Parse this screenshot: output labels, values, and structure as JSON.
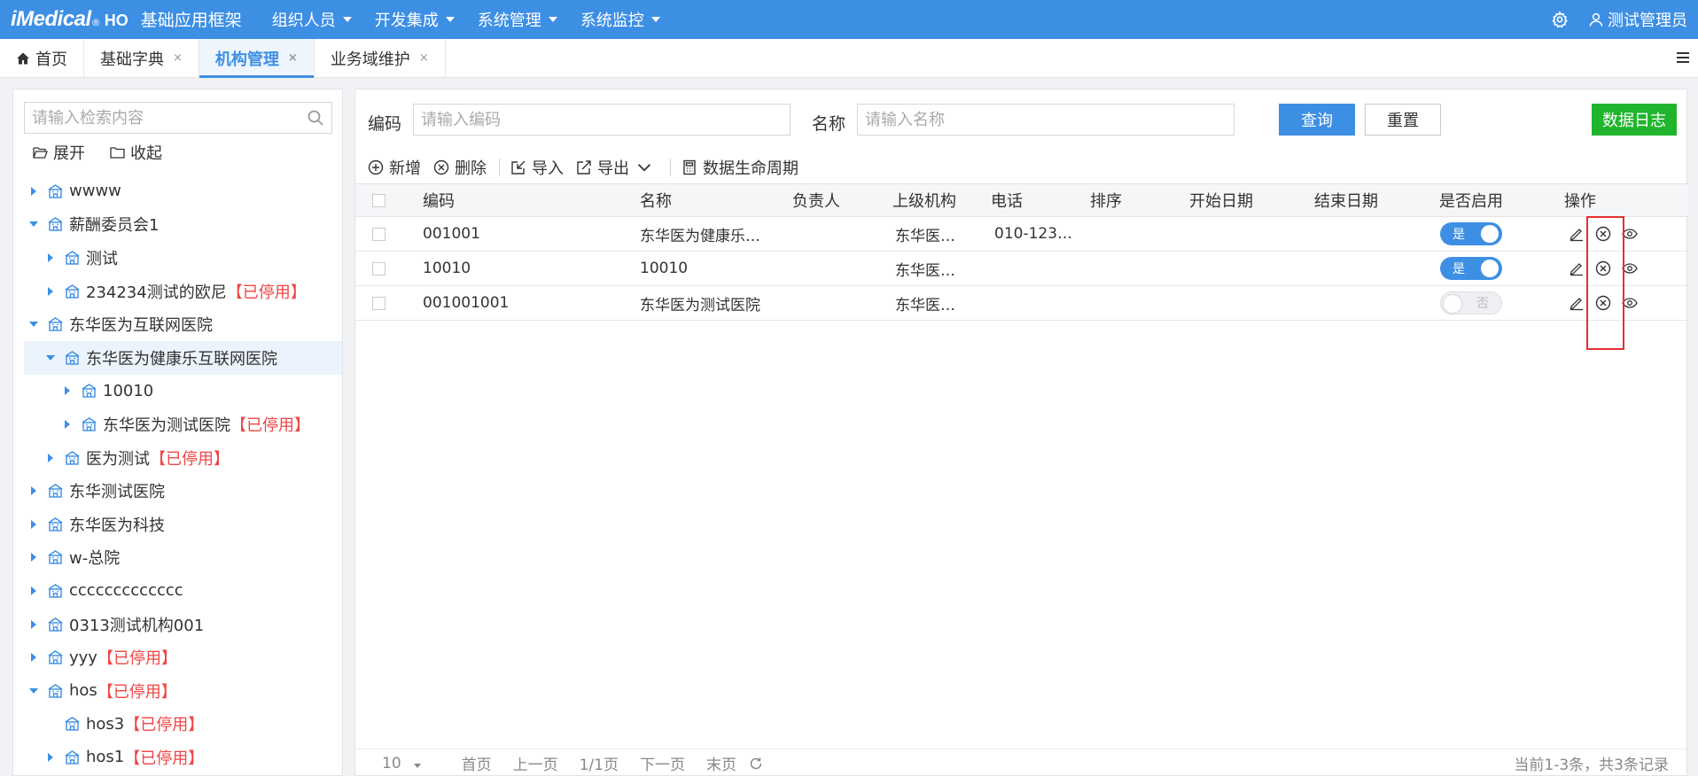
{
  "header": {
    "brand_logo": "iMedical",
    "brand_reg": "®",
    "brand_ho": "HO",
    "brand_title": "基础应用框架",
    "nav": [
      "组织人员",
      "开发集成",
      "系统管理",
      "系统监控"
    ],
    "user_name": "测试管理员"
  },
  "tabs": [
    {
      "label": "首页",
      "closable": false
    },
    {
      "label": "基础字典",
      "closable": true
    },
    {
      "label": "机构管理",
      "closable": true,
      "active": true
    },
    {
      "label": "业务域维护",
      "closable": true
    }
  ],
  "tab_close_glyph": "×",
  "sidebar": {
    "search_placeholder": "请输入检索内容",
    "expand_label": "展开",
    "collapse_label": "收起",
    "disabled_suffix": "【已停用】",
    "tree": [
      {
        "label": "wwww",
        "level": 0,
        "toggle": "right",
        "disabled": false
      },
      {
        "label": "薪酬委员会1",
        "level": 0,
        "toggle": "down",
        "disabled": false
      },
      {
        "label": "测试",
        "level": 1,
        "toggle": "right",
        "disabled": false
      },
      {
        "label": "234234测试的欧尼",
        "level": 1,
        "toggle": "right",
        "disabled": true
      },
      {
        "label": "东华医为互联网医院",
        "level": 0,
        "toggle": "down",
        "disabled": false
      },
      {
        "label": "东华医为健康乐互联网医院",
        "level": 1,
        "toggle": "down",
        "disabled": false,
        "selected": true
      },
      {
        "label": "10010",
        "level": 2,
        "toggle": "right",
        "disabled": false
      },
      {
        "label": "东华医为测试医院",
        "level": 2,
        "toggle": "right",
        "disabled": true
      },
      {
        "label": "医为测试",
        "level": 1,
        "toggle": "right",
        "disabled": true
      },
      {
        "label": "东华测试医院",
        "level": 0,
        "toggle": "right",
        "disabled": false
      },
      {
        "label": "东华医为科技",
        "level": 0,
        "toggle": "right",
        "disabled": false
      },
      {
        "label": "w-总院",
        "level": 0,
        "toggle": "right",
        "disabled": false
      },
      {
        "label": "ccccccccccccc",
        "level": 0,
        "toggle": "right",
        "disabled": false
      },
      {
        "label": "0313测试机构001",
        "level": 0,
        "toggle": "right",
        "disabled": false
      },
      {
        "label": "yyy",
        "level": 0,
        "toggle": "right",
        "disabled": true
      },
      {
        "label": "hos",
        "level": 0,
        "toggle": "down",
        "disabled": true
      },
      {
        "label": "hos3",
        "level": 1,
        "toggle": "none",
        "disabled": true
      },
      {
        "label": "hos1",
        "level": 1,
        "toggle": "right",
        "disabled": true
      }
    ]
  },
  "filters": {
    "code_label": "编码",
    "code_placeholder": "请输入编码",
    "name_label": "名称",
    "name_placeholder": "请输入名称",
    "query_button": "查询",
    "reset_button": "重置",
    "log_button": "数据日志"
  },
  "toolbar": {
    "add": "新增",
    "delete": "删除",
    "import": "导入",
    "export": "导出",
    "lifecycle": "数据生命周期"
  },
  "table": {
    "columns": [
      "编码",
      "名称",
      "负责人",
      "上级机构",
      "电话",
      "排序",
      "开始日期",
      "结束日期",
      "是否启用",
      "操作"
    ],
    "rows": [
      {
        "code": "001001",
        "name": "东华医为健康乐…",
        "owner": "",
        "parent": "东华医…",
        "phone": "010-123…",
        "order": "",
        "start": "",
        "end": "",
        "enabled": true
      },
      {
        "code": "10010",
        "name": "10010",
        "owner": "",
        "parent": "东华医…",
        "phone": "",
        "order": "",
        "start": "",
        "end": "",
        "enabled": true
      },
      {
        "code": "001001001",
        "name": "东华医为测试医院",
        "owner": "",
        "parent": "东华医…",
        "phone": "",
        "order": "",
        "start": "",
        "end": "",
        "enabled": false
      }
    ],
    "switch_on": "是",
    "switch_off": "否"
  },
  "pager": {
    "page_size": "10",
    "first": "首页",
    "prev": "上一页",
    "page_info": "1/1页",
    "next": "下一页",
    "last": "末页",
    "summary": "当前1-3条，共3条记录"
  },
  "colors": {
    "primary": "#3d8fe4",
    "success": "#21b52d",
    "danger": "#f04545",
    "highlight": "#e53030"
  }
}
